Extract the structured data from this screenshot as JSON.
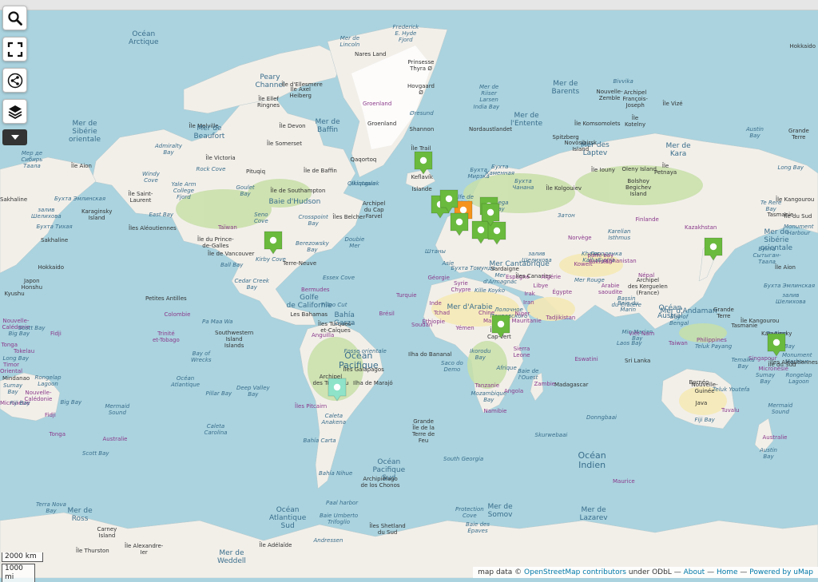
{
  "controls": {
    "search": "search-icon",
    "fullscreen": "fullscreen-icon",
    "share": "share-icon",
    "layers": "layers-icon",
    "more": "chevron-down-icon"
  },
  "colors": {
    "water": "#aad3df",
    "land": "#f2efe9",
    "forest": "#c8dfa8",
    "desert": "#f5e9b6",
    "ice": "#f8f8f8",
    "marker_green": "#6aba3e",
    "marker_orange": "#f5941d",
    "marker_teal": "#8ee3c8"
  },
  "labels": [
    {
      "t": "Océan\nArctique",
      "c": "w mid"
    },
    {
      "t": "Frederick\nE. Hyde\nFjord",
      "c": "w"
    },
    {
      "t": "Mer de\nLincoln",
      "c": "w"
    },
    {
      "t": "Nares Land",
      "c": ""
    },
    {
      "t": "Prinsesse\nThyra Ø",
      "c": ""
    },
    {
      "t": "Peary\nChannel",
      "c": "w mid"
    },
    {
      "t": "Île d'Ellesmere",
      "c": ""
    },
    {
      "t": "Île Axel\nHeiberg",
      "c": ""
    },
    {
      "t": "Île Ellef\nRingnes",
      "c": ""
    },
    {
      "t": "Île Melville",
      "c": ""
    },
    {
      "t": "Île Devon",
      "c": ""
    },
    {
      "t": "Mer de\nBeaufort",
      "c": "w mid"
    },
    {
      "t": "Île Somerset",
      "c": ""
    },
    {
      "t": "Mer de\nBaffin",
      "c": "w mid"
    },
    {
      "t": "Groenland",
      "c": "p"
    },
    {
      "t": "Groenland",
      "c": ""
    },
    {
      "t": "Hovgaard\nØ",
      "c": ""
    },
    {
      "t": "Øresund",
      "c": "w"
    },
    {
      "t": "Shannon",
      "c": ""
    },
    {
      "t": "Île Trail",
      "c": ""
    },
    {
      "t": "Qaqortoq",
      "c": ""
    },
    {
      "t": "Île Victoria",
      "c": ""
    },
    {
      "t": "Rock Cove",
      "c": "w"
    },
    {
      "t": "Pituqiq",
      "c": ""
    },
    {
      "t": "Île de Baffin",
      "c": ""
    },
    {
      "t": "Qikiqtaaluk",
      "c": "w"
    },
    {
      "t": "Admiralty\nBay",
      "c": "w"
    },
    {
      "t": "Windy\nCove",
      "c": "w"
    },
    {
      "t": "Yale Arm\nCollege\nFjord",
      "c": "w"
    },
    {
      "t": "Goulet\nBay",
      "c": "w"
    },
    {
      "t": "Île de Southampton",
      "c": ""
    },
    {
      "t": "Baie d'Hudson",
      "c": "w mid"
    },
    {
      "t": "Archipel\ndu Cap\nFarvel",
      "c": ""
    },
    {
      "t": "Ikinngua",
      "c": "w"
    },
    {
      "t": "Islande",
      "c": ""
    },
    {
      "t": "Keflavík",
      "c": ""
    },
    {
      "t": "Mer de\nSibérie\norientale",
      "c": "w mid"
    },
    {
      "t": "Мер де\nСибирь\nТаала",
      "c": "w"
    },
    {
      "t": "Île Aion",
      "c": ""
    },
    {
      "t": "Île Saint-\nLaurent",
      "c": ""
    },
    {
      "t": "Бухта Эмлинская",
      "c": "w"
    },
    {
      "t": "East Bay",
      "c": "w"
    },
    {
      "t": "Karaginsky\nIsland",
      "c": ""
    },
    {
      "t": "залив\nШелихова",
      "c": "w"
    },
    {
      "t": "Îles Aléoutiennes",
      "c": ""
    },
    {
      "t": "Бухта Тихая",
      "c": "w"
    },
    {
      "t": "Sakhaline",
      "c": ""
    },
    {
      "t": "Hokkaido",
      "c": ""
    },
    {
      "t": "Japon\nHonshu",
      "c": ""
    },
    {
      "t": "Kyushu",
      "c": ""
    },
    {
      "t": "Taïwan",
      "c": "p"
    },
    {
      "t": "Île du Prince-\nde-Galles",
      "c": ""
    },
    {
      "t": "Île de Vancouver",
      "c": ""
    },
    {
      "t": "Ball Bay",
      "c": "w"
    },
    {
      "t": "Kirby Cove",
      "c": "w"
    },
    {
      "t": "Seno\nCove",
      "c": "w"
    },
    {
      "t": "Berezowsky\nBay",
      "c": "w"
    },
    {
      "t": "Crosspoint\nBay",
      "c": "w"
    },
    {
      "t": "Îles Belcher",
      "c": ""
    },
    {
      "t": "Doubie\nMer",
      "c": "w"
    },
    {
      "t": "Terre-Neuve",
      "c": ""
    },
    {
      "t": "Essex Cove",
      "c": "w"
    },
    {
      "t": "Cedar Creek\nBay",
      "c": "w"
    },
    {
      "t": "Bermudes",
      "c": "p"
    },
    {
      "t": "Golfe\nde Californie",
      "c": "w mid"
    },
    {
      "t": "Tilloo Cut",
      "c": "w"
    },
    {
      "t": "Les Bahamas",
      "c": ""
    },
    {
      "t": "Îles Turques-\net-Caïques",
      "c": ""
    },
    {
      "t": "Anguilla",
      "c": "p"
    },
    {
      "t": "Bahía\nGarza",
      "c": "w mid"
    },
    {
      "t": "Petites Antilles",
      "c": ""
    },
    {
      "t": "Colombie",
      "c": "p"
    },
    {
      "t": "Trinité\net-Tobago",
      "c": "p"
    },
    {
      "t": "Pa Maa Wa",
      "c": "w"
    },
    {
      "t": "Southwestern\nIsland\nIslands",
      "c": ""
    },
    {
      "t": "Bay of\nWrecks",
      "c": "w"
    },
    {
      "t": "Fosse orientale",
      "c": "w"
    },
    {
      "t": "Océan\nPacifique",
      "c": "w big"
    },
    {
      "t": "Îles Galapagos",
      "c": ""
    },
    {
      "t": "Ilha de Marajó",
      "c": ""
    },
    {
      "t": "Brésil",
      "c": "p"
    },
    {
      "t": "Ilha do Bananal",
      "c": ""
    },
    {
      "t": "Saco do\nDemo",
      "c": "w"
    },
    {
      "t": "Océan\nAtlantique",
      "c": "w"
    },
    {
      "t": "Pillar Bay",
      "c": "w"
    },
    {
      "t": "Deep Valley\nBay",
      "c": "w"
    },
    {
      "t": "Archipel\ndes Tuamotu",
      "c": ""
    },
    {
      "t": "Îles Pitcairn",
      "c": "p"
    },
    {
      "t": "Caleta\nAnakena",
      "c": "w"
    },
    {
      "t": "Caleta\nCarolina",
      "c": "w"
    },
    {
      "t": "Bahía Carta",
      "c": "w"
    },
    {
      "t": "Bahía Nihue",
      "c": "w"
    },
    {
      "t": "Océan\nPacifique\nSud",
      "c": "w mid"
    },
    {
      "t": "Archipiélago\nde los Chonos",
      "c": ""
    },
    {
      "t": "Grande\nÎle de la\nTerre de\nFeu",
      "c": ""
    },
    {
      "t": "South Georgia",
      "c": "w"
    },
    {
      "t": "Paal harbor",
      "c": "w"
    },
    {
      "t": "Océan\nAtlantique\nSud",
      "c": "w mid"
    },
    {
      "t": "Baie Umberto\nTrifoglio",
      "c": "w"
    },
    {
      "t": "Îles Shetland\ndu Sud",
      "c": ""
    },
    {
      "t": "Andressen",
      "c": "w"
    },
    {
      "t": "Île Adélaïde",
      "c": ""
    },
    {
      "t": "Mer de\nWeddell",
      "c": "w mid"
    },
    {
      "t": "Île Alexandre-\nIer",
      "c": ""
    },
    {
      "t": "Île Thurston",
      "c": ""
    },
    {
      "t": "Carney\nIsland",
      "c": ""
    },
    {
      "t": "Mer de\nRoss",
      "c": "w mid"
    },
    {
      "t": "Terra Nova\nBay",
      "c": "w"
    },
    {
      "t": "Protection\nCove",
      "c": "w"
    },
    {
      "t": "Mer de\nSomov",
      "c": "w mid"
    },
    {
      "t": "Baie des\nÉpaves",
      "c": "w"
    },
    {
      "t": "Mer de\nLazarev",
      "c": "w mid"
    },
    {
      "t": "Mer de\nRiiser\nLarsen",
      "c": "w"
    },
    {
      "t": "India Bay",
      "c": "w"
    },
    {
      "t": "Mer de\nl'Entente",
      "c": "w mid"
    },
    {
      "t": "Nordaustlandet",
      "c": ""
    },
    {
      "t": "Spitzberg",
      "c": ""
    },
    {
      "t": "Mer de\nBarents",
      "c": "w mid"
    },
    {
      "t": "Bivvika",
      "c": "w"
    },
    {
      "t": "Nouvelle-\nZemble",
      "c": ""
    },
    {
      "t": "Archipel\nFrançois-\nJoseph",
      "c": ""
    },
    {
      "t": "Île Komsomolets",
      "c": ""
    },
    {
      "t": "Île Vizé",
      "c": ""
    },
    {
      "t": "Île\nKotelny",
      "c": ""
    },
    {
      "t": "Mer de\nKara",
      "c": "w mid"
    },
    {
      "t": "Mer des\nLaptev",
      "c": "w mid"
    },
    {
      "t": "Novosibirsk\nIsland",
      "c": ""
    },
    {
      "t": "Île\nPetnaya",
      "c": ""
    },
    {
      "t": "Île Iouny",
      "c": ""
    },
    {
      "t": "Olenу Island",
      "c": ""
    },
    {
      "t": "Bolshoy\nBegichev\nIsland",
      "c": ""
    },
    {
      "t": "Бухта\nКаменная",
      "c": "w"
    },
    {
      "t": "Бухта\nМирзка",
      "c": "w"
    },
    {
      "t": "Бухта\nЧанана",
      "c": "w"
    },
    {
      "t": "Île Kolgouiev",
      "c": ""
    },
    {
      "t": "Golfe de\nBothnie",
      "c": "w"
    },
    {
      "t": "Onega\nBay",
      "c": "w"
    },
    {
      "t": "Затон",
      "c": "w"
    },
    {
      "t": "Norvège",
      "c": "p"
    },
    {
      "t": "Karelian\nIsthmus",
      "c": "w"
    },
    {
      "t": "Finlande",
      "c": "p"
    },
    {
      "t": "Городенка\nБухта",
      "c": "w"
    },
    {
      "t": "Kazakhstan",
      "c": "p"
    },
    {
      "t": "Штаны",
      "c": "w"
    },
    {
      "t": "Asie",
      "c": "w"
    },
    {
      "t": "Бухта Томунда",
      "c": "w"
    },
    {
      "t": "залив\nШелихова",
      "c": "w"
    },
    {
      "t": "Mer Cantabrique",
      "c": "w mid"
    },
    {
      "t": "Espagne",
      "c": "p"
    },
    {
      "t": "Sardaigne",
      "c": ""
    },
    {
      "t": "Géorgie",
      "c": "p"
    },
    {
      "t": "Turquie",
      "c": "p"
    },
    {
      "t": "Syrie\nChypre",
      "c": "p"
    },
    {
      "t": "Kille Koyko",
      "c": "w"
    },
    {
      "t": "Mer\nd'Armagnac",
      "c": "w"
    },
    {
      "t": "Îles Canaries",
      "c": ""
    },
    {
      "t": "Algérie",
      "c": "p"
    },
    {
      "t": "Libye",
      "c": "p"
    },
    {
      "t": "Égypte",
      "c": "p"
    },
    {
      "t": "Irak",
      "c": "p"
    },
    {
      "t": "Iran",
      "c": "p"
    },
    {
      "t": "Koweït",
      "c": "p"
    },
    {
      "t": "Khawr\nKalba",
      "c": "w"
    },
    {
      "t": "Arabie\nsaoudite",
      "c": "p"
    },
    {
      "t": "Mer Rouge",
      "c": "w"
    },
    {
      "t": "Afghanistan",
      "c": "p"
    },
    {
      "t": "Tadjikistan",
      "c": "p"
    },
    {
      "t": "Népal",
      "c": "p"
    },
    {
      "t": "pami bay\nPakistan",
      "c": "p"
    },
    {
      "t": "Inde",
      "c": "p"
    },
    {
      "t": "Mer d'Arabie",
      "c": "w mid"
    },
    {
      "t": "Chine",
      "c": "p"
    },
    {
      "t": "Лолочное\nПокровского",
      "c": "w"
    },
    {
      "t": "Mauritanie",
      "c": "p"
    },
    {
      "t": "Niger",
      "c": "p"
    },
    {
      "t": "Tchad",
      "c": "p"
    },
    {
      "t": "Soudan",
      "c": "p"
    },
    {
      "t": "Éthiopie",
      "c": "p"
    },
    {
      "t": "Yémen",
      "c": "p"
    },
    {
      "t": "Mali",
      "c": "p"
    },
    {
      "t": "Îles du\nCap-Vert",
      "c": ""
    },
    {
      "t": "Sierra\nLeone",
      "c": "p"
    },
    {
      "t": "Ikorodu\nBay",
      "c": "w"
    },
    {
      "t": "Afrique",
      "c": "w"
    },
    {
      "t": "Baie de\nl'Ouest",
      "c": "w"
    },
    {
      "t": "Tanzanie",
      "c": "p"
    },
    {
      "t": "Angola",
      "c": "p"
    },
    {
      "t": "Zambie",
      "c": "p"
    },
    {
      "t": "Mozambique\nBay",
      "c": "w"
    },
    {
      "t": "Namibie",
      "c": "p"
    },
    {
      "t": "Eswatini",
      "c": "p"
    },
    {
      "t": "Madagascar",
      "c": ""
    },
    {
      "t": "Donngbaai",
      "c": "w"
    },
    {
      "t": "Skurwebaai",
      "c": "w"
    },
    {
      "t": "Océan\nIndien",
      "c": "w big"
    },
    {
      "t": "Maurice",
      "c": "p"
    },
    {
      "t": "Bassin\ndu Cratère",
      "c": "w"
    },
    {
      "t": "Baie du\nMarin",
      "c": "w"
    },
    {
      "t": "Archipel\ndes Kerguelen\n(France)",
      "c": ""
    },
    {
      "t": "Océan\nAustral",
      "c": "w mid"
    },
    {
      "t": "Bay of\nBengal",
      "c": "w"
    },
    {
      "t": "Min Marjan\nBay",
      "c": "w"
    },
    {
      "t": "Mer d'Andaman",
      "c": "w mid"
    },
    {
      "t": "Viêt Nam",
      "c": "p"
    },
    {
      "t": "Laos Bay",
      "c": "w"
    },
    {
      "t": "Taiwan",
      "c": "p"
    },
    {
      "t": "Philippines",
      "c": "p"
    },
    {
      "t": "Sri Lanka",
      "c": ""
    },
    {
      "t": "Teluk Payang",
      "c": "w"
    },
    {
      "t": "Singapour",
      "c": "p"
    },
    {
      "t": "Bornéo",
      "c": ""
    },
    {
      "t": "Nouvelle-\nGuinée",
      "c": ""
    },
    {
      "t": "Java",
      "c": ""
    },
    {
      "t": "Teluk Youtefa",
      "c": "w"
    },
    {
      "t": "Fiji Bay",
      "c": "w"
    },
    {
      "t": "Mermaid\nSound",
      "c": "w"
    },
    {
      "t": "Australie",
      "c": "p"
    },
    {
      "t": "Austin\nBay",
      "c": "w"
    },
    {
      "t": "Grande\nTerre",
      "c": ""
    },
    {
      "t": "Île Kangourou",
      "c": ""
    },
    {
      "t": "Tasmanie",
      "c": ""
    },
    {
      "t": "Te Rere\nBay",
      "c": "w"
    },
    {
      "t": "Île du Sud",
      "c": ""
    },
    {
      "t": "Monument\nHarbour",
      "c": "w"
    },
    {
      "t": "Sumay\nBay",
      "c": "w"
    },
    {
      "t": "Rongelap\nLagoon",
      "c": "w"
    },
    {
      "t": "Micronésie",
      "c": "p"
    },
    {
      "t": "Temaiku\nBay",
      "c": "w"
    },
    {
      "t": "Tuvalu",
      "c": "p"
    },
    {
      "t": "Tokelau",
      "c": "p"
    },
    {
      "t": "Fidji",
      "c": "p"
    },
    {
      "t": "Tonga",
      "c": "p"
    },
    {
      "t": "Big Bay",
      "c": "w"
    },
    {
      "t": "Nouvelle-\nCalédonie",
      "c": "p"
    },
    {
      "t": "Scott Bay",
      "c": "w"
    },
    {
      "t": "Long Bay",
      "c": "w"
    },
    {
      "t": "Timor\nOriental",
      "c": "p"
    },
    {
      "t": "Mindanao",
      "c": ""
    },
    {
      "t": "Sumay\nBay",
      "c": "w"
    },
    {
      "t": "Rongelap\nLagoon",
      "c": "w"
    },
    {
      "t": "Micronésie",
      "c": "p"
    },
    {
      "t": "Fiji Bay",
      "c": "w"
    },
    {
      "t": "Big Bay",
      "c": "w"
    },
    {
      "t": "Nouvelle-\nCalédonie",
      "c": "p"
    },
    {
      "t": "Fidji",
      "c": "p"
    },
    {
      "t": "Tonga",
      "c": "p"
    },
    {
      "t": "Mermaid\nSound",
      "c": "w"
    },
    {
      "t": "Australie",
      "c": "p"
    },
    {
      "t": "Scott Bay",
      "c": "w"
    },
    {
      "t": "Austin\nBay",
      "c": "w"
    },
    {
      "t": "Grande\nTerre",
      "c": ""
    },
    {
      "t": "Long Bay",
      "c": "w"
    },
    {
      "t": "Île Kangourou",
      "c": ""
    },
    {
      "t": "Te Rere\nBay",
      "c": "w"
    },
    {
      "t": "Tasmanie",
      "c": ""
    },
    {
      "t": "Île du Sud",
      "c": ""
    },
    {
      "t": "Monument\nHarbour",
      "c": "w"
    },
    {
      "t": "Mer de\nSibérie\norientale",
      "c": "w mid"
    },
    {
      "t": "Бухта\nСытыган-\nТаала",
      "c": "w"
    },
    {
      "t": "Île Aion",
      "c": ""
    },
    {
      "t": "Бухта Эмлинская",
      "c": "w"
    },
    {
      "t": "залив\nШелихова",
      "c": "w"
    },
    {
      "t": "Karaginsky\nIsland",
      "c": ""
    },
    {
      "t": "East Bay",
      "c": "w"
    },
    {
      "t": "Îles Aléoutiennes",
      "c": ""
    },
    {
      "t": "Sakhaline",
      "c": ""
    },
    {
      "t": "Hokkaido",
      "c": ""
    },
    {
      "t": "Japon\nHonshu",
      "c": ""
    },
    {
      "t": "Kyushu",
      "c": ""
    },
    {
      "t": "Taïwan",
      "c": "p"
    },
    {
      "t": "Mindanao",
      "c": ""
    },
    {
      "t": "Timor\nOriental",
      "c": "p"
    },
    {
      "t": "Teluk Youtefa",
      "c": "w"
    },
    {
      "t": "Temaiku\nBay",
      "c": "w"
    },
    {
      "t": "Tuvalu",
      "c": "p"
    },
    {
      "t": "Île Saint-\nLaurent",
      "c": ""
    },
    {
      "t": "Océan\nArctique",
      "c": "w mid"
    }
  ],
  "markers": [
    {
      "color": "green"
    },
    {
      "color": "green"
    },
    {
      "color": "green"
    },
    {
      "color": "orange"
    },
    {
      "color": "green"
    },
    {
      "color": "green"
    },
    {
      "color": "green"
    },
    {
      "color": "green"
    },
    {
      "color": "green"
    },
    {
      "color": "green"
    },
    {
      "color": "green"
    },
    {
      "color": "green"
    },
    {
      "color": "green"
    },
    {
      "color": "teal"
    }
  ],
  "scale": {
    "top": "2000 km",
    "bottom": "1000 mi"
  },
  "attribution": {
    "prefix": "map data ©",
    "osm": "OpenStreetMap contributors",
    "license": "under ODbL",
    "sep1": "—",
    "about": "About",
    "sep2": "—",
    "home": "Home",
    "sep3": "—",
    "powered": "Powered by uMap"
  }
}
